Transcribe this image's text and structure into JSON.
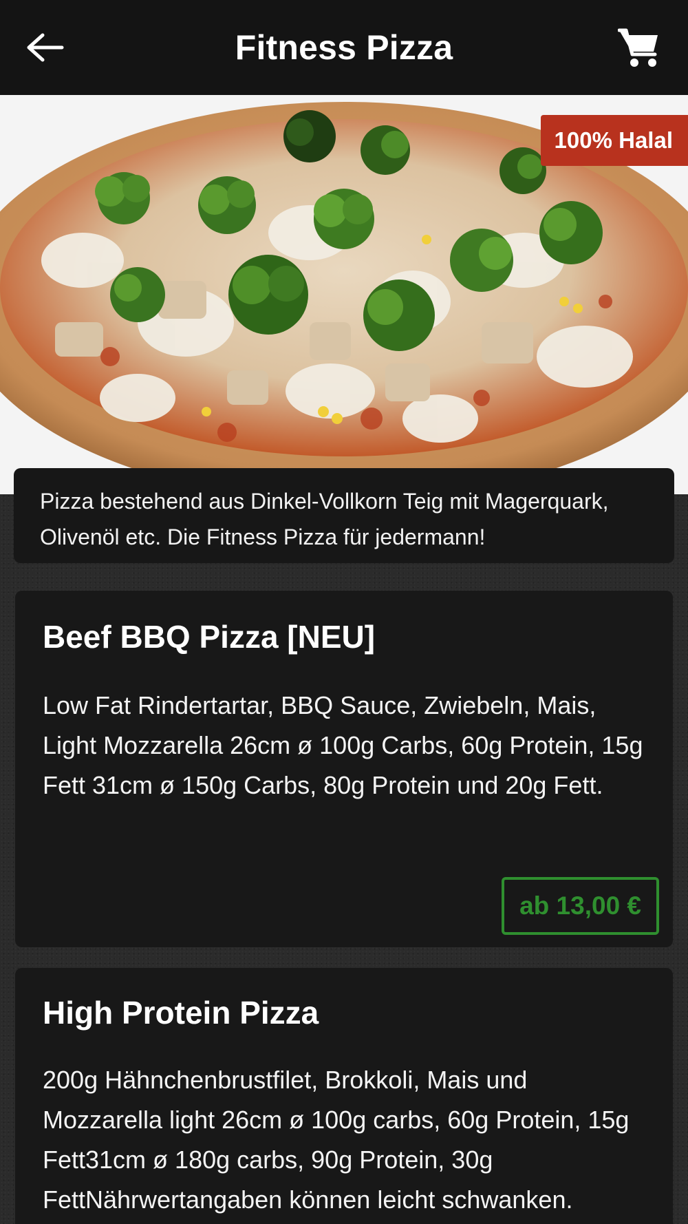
{
  "header": {
    "title": "Fitness Pizza"
  },
  "hero": {
    "badge": "100% Halal"
  },
  "category_description": "Pizza bestehend aus Dinkel-Vollkorn Teig mit Magerquark, Olivenöl etc. Die Fitness Pizza für jedermann!",
  "products": [
    {
      "name": "Beef BBQ Pizza [NEU]",
      "description": "Low Fat Rindertartar, BBQ Sauce, Zwiebeln, Mais, Light Mozzarella 26cm ø 100g Carbs, 60g Protein, 15g Fett 31cm ø 150g Carbs, 80g Protein und 20g Fett.",
      "price": "ab 13,00 €"
    },
    {
      "name": "High Protein Pizza",
      "description": "200g Hähnchenbrustfilet, Brokkoli, Mais und Mozzarella light 26cm ø 100g carbs, 60g Protein, 15g Fett31cm ø 180g carbs, 90g Protein, 30g FettNährwertangaben können leicht schwanken."
    }
  ],
  "colors": {
    "header_bg": "#141414",
    "badge_bg": "#b8321e",
    "price_accent": "#2f8f2f",
    "card_bg": "#181818"
  },
  "icons": {
    "back": "arrow-left-icon",
    "cart": "shopping-cart-icon"
  }
}
